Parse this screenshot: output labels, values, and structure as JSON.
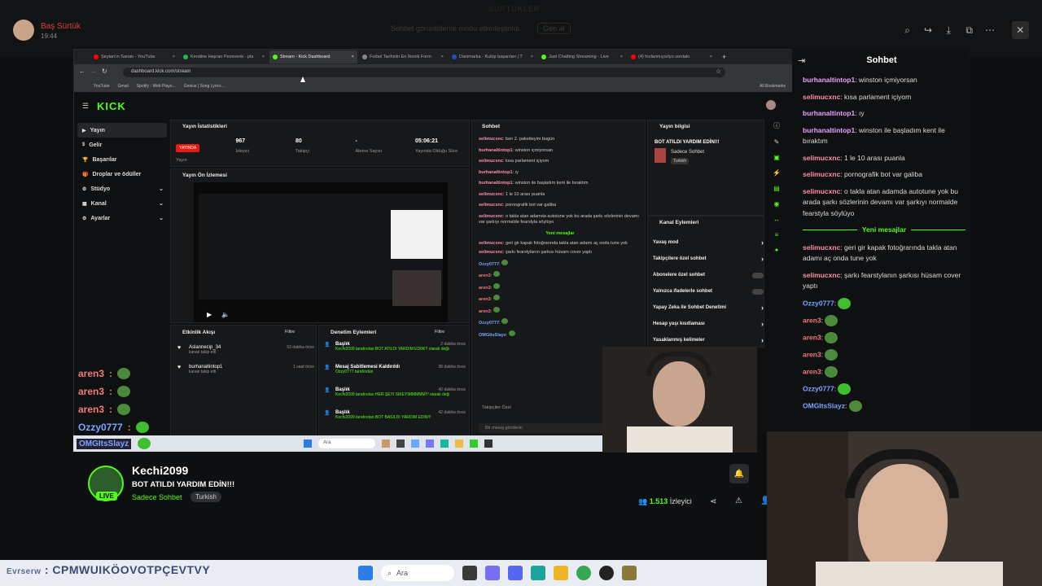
{
  "viewer": {
    "username": "Baş Sürtük",
    "time": "19:44",
    "notice": "Sohbet görüntüleme modu etkinleştirildi.",
    "notice_button": "Geri al",
    "ghost_title": "SÜRTÜKLER"
  },
  "browser": {
    "tabs": [
      {
        "label": "Şeytan'ın Sanatı - YouTube",
        "color": "#ff0000"
      },
      {
        "label": "Kendine Hayran Pezevenk - pla",
        "color": "#1db954"
      },
      {
        "label": "Stream - Kick Dashboard",
        "color": "#53fc18",
        "active": true
      },
      {
        "label": "Futbol Tarihinin En İkonik Form",
        "color": "#888888"
      },
      {
        "label": "Danimarka - Kulüp başarıları | T",
        "color": "#1a4fc4"
      },
      {
        "label": "Just Chatting Streaming - Live",
        "color": "#53fc18"
      },
      {
        "label": "(4) hızlanmıyorlyo sordakı",
        "color": "#ff0000"
      }
    ],
    "url": "dashboard.kick.com/stream",
    "bookmarks": [
      "YouTube",
      "Gmail",
      "Spotify - Web Playe...",
      "Genius | Song Lyrics..."
    ],
    "all_bookmarks": "All Bookmarks"
  },
  "dashboard": {
    "logo": "KICK",
    "nav": [
      "Yayın",
      "Gelir",
      "Başarılar",
      "Droplar ve ödüller",
      "Stüdyo",
      "Kanal",
      "Ayarlar"
    ],
    "stats_title": "Yayın İstatistikleri",
    "stats": [
      {
        "value": "YAYINDA",
        "label": "Yayın"
      },
      {
        "value": "967",
        "label": "İzleyici"
      },
      {
        "value": "80",
        "label": "Takipçi"
      },
      {
        "value": "-",
        "label": "Abone Sayısı"
      },
      {
        "value": "05:06:21",
        "label": "Yayında Olduğu Süre"
      }
    ],
    "preview_title": "Yayın Ön İzlemesi",
    "activity_title": "Etkinlik Akışı",
    "filter": "Filtre",
    "activity": [
      {
        "user": "Aslannecip_34",
        "action": "kanalı takip etti",
        "time": "53 dakika önce"
      },
      {
        "user": "burhanaltintop1",
        "action": "kanalı takip etti",
        "time": "1 saat önce"
      }
    ],
    "mod_title": "Denetim Eylemleri",
    "mod_actions": [
      {
        "title": "Başlık",
        "text": "Kechi2099 tarafından BOT ATILDI YARDIM EDİN!!! olarak değiştirildi",
        "time": "2 dakika önce"
      },
      {
        "title": "Mesaj Sabitlemesi Kaldırıldı",
        "text": "Ozzy0777 tarafından",
        "time": "38 dakika önce"
      },
      {
        "title": "Başlık",
        "text": "Kechi2099 tarafından HER ŞEYİ SİKEYİMMMMM!!! olarak değiştirildi",
        "time": "40 dakika önce"
      },
      {
        "title": "Başlık",
        "text": "Kechi2099 tarafından BOT BASILDI YARDIM EDİN!!!",
        "time": "42 dakika önce"
      }
    ],
    "chat_title": "Sohbet",
    "chat_lines": [
      {
        "u": "selimucxnc",
        "t": "ben 2. paketteyim bugün"
      },
      {
        "u": "burhanaltintop1",
        "t": "winston içmiyorsan"
      },
      {
        "u": "selimucxnc",
        "t": "kısa parlament içiyom"
      },
      {
        "u": "burhanaltintop1",
        "t": "ıy"
      },
      {
        "u": "burhanaltintop1",
        "t": "winston ile başladım kent ile bıraktım"
      },
      {
        "u": "selimucxnc",
        "t": "1 le 10 arası puanla"
      },
      {
        "u": "selimucxnc",
        "t": "pornografik bot var galiba"
      },
      {
        "u": "selimucxnc",
        "t": "o takla atan adamda autotune yok bu arada şarkı sözlerinin devamı var şarkıyı normalde fearstyla söylüyo"
      }
    ],
    "new_messages": "Yeni mesajlar",
    "chat_after": [
      {
        "u": "selimucxnc",
        "t": "geri gir kapak fotoğrarında takla atan adamı aç onda tune yok"
      },
      {
        "u": "selimucxnc",
        "t": "şarkı fearstylanın şarkısı hüsam cover yaptı"
      },
      {
        "u": "Ozzy0777",
        "t": ""
      },
      {
        "u": "aren3",
        "t": ""
      },
      {
        "u": "aren3",
        "t": ""
      },
      {
        "u": "aren3",
        "t": ""
      },
      {
        "u": "aren3",
        "t": ""
      },
      {
        "u": "Ozzy0777",
        "t": ""
      },
      {
        "u": "OMGItsSlayz",
        "t": ""
      }
    ],
    "followers_only": "Takipçiler Özel",
    "chat_placeholder": "Bir mesaj gönderin",
    "info_title": "Yayın bilgisi",
    "info_stream_title": "BOT ATILDI YARDIM EDİN!!!",
    "info_category": "Sadece Sohbet",
    "info_lang": "Turkish",
    "channel_actions_title": "Kanal Eylemleri",
    "channel_actions": [
      "Yavaş mod",
      "Takipçilere özel sohbet",
      "Abonelere özel sohbet",
      "Yalnızca ifadelerle sohbet",
      "Yapay Zeka ile Sohbet Denetimi",
      "Hesap yaşı kısıtlaması",
      "Yasaklanmış kelimeler"
    ]
  },
  "overlay_chat": [
    {
      "u": "aren3",
      "color": "#f47a7a"
    },
    {
      "u": "aren3",
      "color": "#f47a7a"
    },
    {
      "u": "aren3",
      "color": "#f47a7a"
    },
    {
      "u": "Ozzy0777",
      "color": "#7aa6ff"
    }
  ],
  "overlay_extra": "OMGItsSlayz",
  "mini_taskbar_search": "Ara",
  "stream": {
    "name": "Kechi2099",
    "title": "BOT ATILDI YARDIM EDİN!!!",
    "category": "Sadece Sohbet",
    "language": "Turkish",
    "live": "LIVE",
    "viewers": "1.513",
    "viewers_label": "İzleyici"
  },
  "chat": {
    "title": "Sohbet",
    "messages_before": [
      {
        "u": "burhanaltintop1",
        "t": "winston içmiyorsan",
        "color": "#e8a0ff"
      },
      {
        "u": "selimucxnc",
        "t": "kısa parlament içiyom",
        "color": "#ff8ea8"
      },
      {
        "u": "burhanaltintop1",
        "t": "ıy",
        "color": "#e8a0ff"
      },
      {
        "u": "burhanaltintop1",
        "t": "winston ile başladım kent ile bıraktım",
        "color": "#e8a0ff"
      },
      {
        "u": "selimucxnc",
        "t": "1 le 10 arası puanla",
        "color": "#ff8ea8"
      },
      {
        "u": "selimucxnc",
        "t": "pornografik bot var galiba",
        "color": "#ff8ea8"
      },
      {
        "u": "selimucxnc",
        "t": "o takla atan adamda autotune yok bu arada şarkı sözlerinin devamı var şarkıyı normalde fearstyla söylüyo",
        "color": "#ff8ea8"
      }
    ],
    "new_messages": "Yeni mesajlar",
    "messages_after": [
      {
        "u": "selimucxnc",
        "t": "geri gir kapak fotoğrarında takla atan adamı aç onda tune yok",
        "color": "#ff8ea8"
      },
      {
        "u": "selimucxnc",
        "t": "şarkı fearstylanın şarkısı hüsam cover yaptı",
        "color": "#ff8ea8"
      },
      {
        "u": "Ozzy0777",
        "t": "",
        "color": "#7aa6ff"
      },
      {
        "u": "aren3",
        "t": "",
        "color": "#f47a7a"
      },
      {
        "u": "aren3",
        "t": "",
        "color": "#f47a7a"
      },
      {
        "u": "aren3",
        "t": "",
        "color": "#f47a7a"
      },
      {
        "u": "aren3",
        "t": "",
        "color": "#f47a7a"
      },
      {
        "u": "Ozzy0777",
        "t": "",
        "color": "#7aa6ff"
      },
      {
        "u": "OMGItsSlayz",
        "t": "",
        "color": "#7aa6ff"
      }
    ]
  },
  "ticker": "CPMWUIKÖOVOTPÇEVTVY",
  "ticker_user": "Evrserw",
  "taskbar_search": "Ara",
  "colors": {
    "kick_green": "#53fc18",
    "live_red": "#e91916"
  }
}
